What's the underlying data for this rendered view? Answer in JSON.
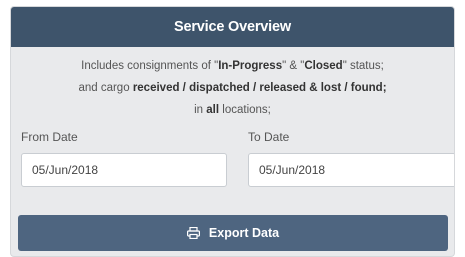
{
  "header": {
    "title": "Service Overview"
  },
  "description": {
    "line1_pre": "Includes consignments of \"",
    "line1_status1": "In-Progress",
    "line1_mid": "\" & \"",
    "line1_status2": "Closed",
    "line1_post": "\" status;",
    "line2_pre": "and cargo ",
    "line2_bold": "received / dispatched / released & lost / found;",
    "line3_pre": "in ",
    "line3_bold": "all",
    "line3_post": " locations;"
  },
  "from_date": {
    "label": "From Date",
    "value": "05/Jun/2018"
  },
  "to_date": {
    "label": "To Date",
    "value": "05/Jun/2018"
  },
  "export": {
    "label": "Export Data",
    "icon": "printer-icon"
  },
  "colors": {
    "header_bg": "#3e546b",
    "button_bg": "#4e6580",
    "panel_bg": "#e9eaec"
  }
}
